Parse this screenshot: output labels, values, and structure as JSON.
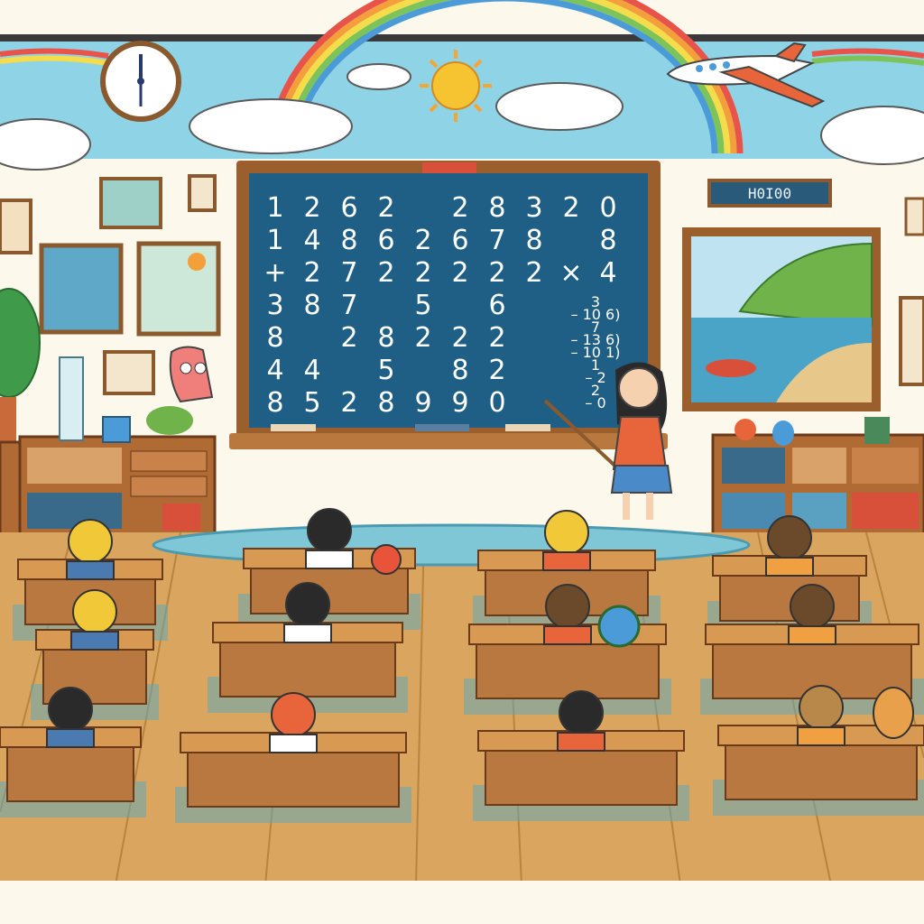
{
  "scene": {
    "wall_color": "#fdf8ec",
    "sky_color": "#8fd3e6",
    "floor_color": "#d9a55f",
    "chalkboard_color": "#1f5f86",
    "frame_color": "#9b5f2e"
  },
  "chalkboard": {
    "rows": [
      [
        "1",
        "2",
        "6",
        "2",
        "",
        "2",
        "8",
        "3",
        "2",
        "0"
      ],
      [
        "1",
        "4",
        "8",
        "6",
        "2",
        "6",
        "7",
        "8",
        "",
        "8"
      ],
      [
        "+",
        "2",
        "7",
        "2",
        "2",
        "2",
        "2",
        "2",
        "×",
        "4"
      ],
      [
        "3",
        "8",
        "7",
        "",
        "5",
        "",
        "6",
        "",
        "",
        ""
      ],
      [
        "8",
        "",
        "2",
        "8",
        "2",
        "2",
        "2",
        "",
        "",
        ""
      ],
      [
        "4",
        "4",
        "",
        "5",
        "",
        "8",
        "2",
        "",
        "",
        ""
      ],
      [
        "8",
        "5",
        "2",
        "8",
        "9",
        "9",
        "0",
        "",
        "",
        ""
      ]
    ],
    "side_notes": [
      "3",
      "– 10 6)",
      "7",
      "– 13 6)",
      "– 10 1)",
      "1",
      "– 2",
      "2",
      "– 0"
    ]
  },
  "sign": {
    "text": "H0I00"
  },
  "icons": [
    "clock-icon",
    "sun-icon",
    "airplane-icon",
    "rainbow-icon",
    "cloud-icon",
    "globe-icon",
    "cat-icon",
    "apple-icon"
  ]
}
